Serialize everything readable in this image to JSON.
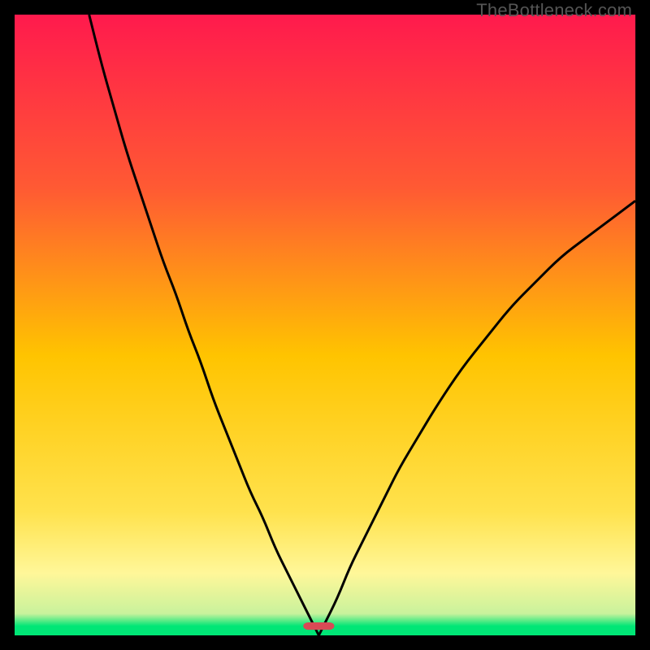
{
  "watermark": {
    "text": "TheBottleneck.com"
  },
  "colors": {
    "top": "#ff1a4d",
    "mid": "#ffd500",
    "lower": "#fff799",
    "green": "#00e676",
    "marker": "#d94a55",
    "curve": "#000000",
    "frame": "#000000"
  },
  "chart_data": {
    "type": "line",
    "title": "",
    "xlabel": "",
    "ylabel": "",
    "xlim": [
      0,
      100
    ],
    "ylim": [
      0,
      100
    ],
    "grid": false,
    "legend": false,
    "annotations": [
      "TheBottleneck.com"
    ],
    "notch_x": 49,
    "marker": {
      "x": 49,
      "y": 1.5,
      "w": 5,
      "h": 2
    },
    "series": [
      {
        "name": "left-branch",
        "x": [
          12,
          14,
          16,
          18,
          20,
          22,
          24,
          26,
          28,
          30,
          32,
          34,
          36,
          38,
          40,
          42,
          44,
          46,
          47,
          48,
          49
        ],
        "values": [
          100,
          92,
          85,
          78,
          72,
          66,
          60,
          55,
          49,
          44,
          38,
          33,
          28,
          23,
          19,
          14,
          10,
          6,
          4,
          2,
          0
        ]
      },
      {
        "name": "right-branch",
        "x": [
          49,
          50,
          52,
          54,
          56,
          58,
          60,
          62,
          65,
          68,
          72,
          76,
          80,
          84,
          88,
          92,
          96,
          100
        ],
        "values": [
          0,
          2,
          6,
          11,
          15,
          19,
          23,
          27,
          32,
          37,
          43,
          48,
          53,
          57,
          61,
          64,
          67,
          70
        ]
      }
    ],
    "background_gradient": [
      {
        "stop": 0.0,
        "color": "#ff1a4d"
      },
      {
        "stop": 0.28,
        "color": "#ff5a33"
      },
      {
        "stop": 0.55,
        "color": "#ffc400"
      },
      {
        "stop": 0.8,
        "color": "#ffe24d"
      },
      {
        "stop": 0.9,
        "color": "#fff799"
      },
      {
        "stop": 0.965,
        "color": "#c9f29c"
      },
      {
        "stop": 0.985,
        "color": "#00e676"
      },
      {
        "stop": 1.0,
        "color": "#00e676"
      }
    ]
  }
}
